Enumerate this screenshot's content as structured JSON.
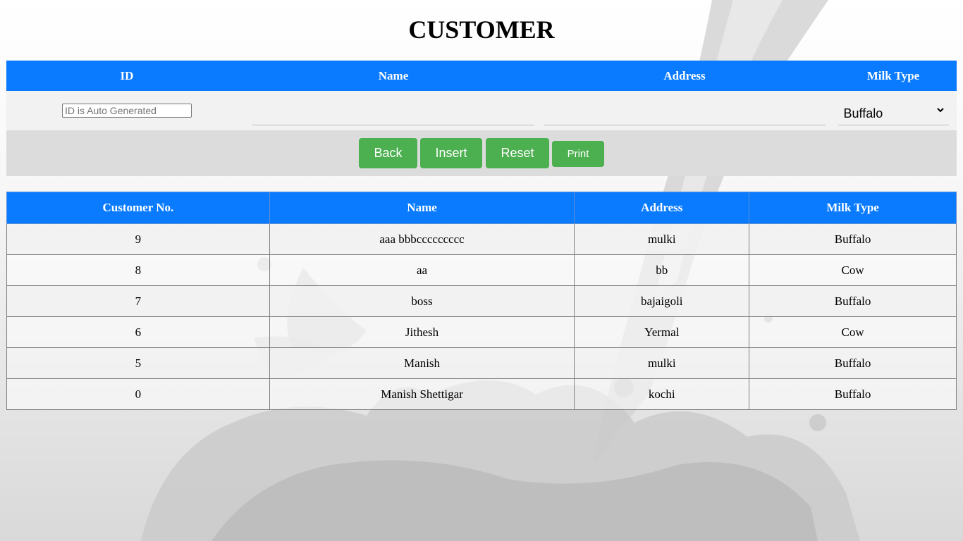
{
  "page": {
    "title": "CUSTOMER"
  },
  "form": {
    "headers": {
      "id": "ID",
      "name": "Name",
      "address": "Address",
      "milk_type": "Milk Type"
    },
    "id_placeholder": "ID is Auto Generated",
    "name_value": "",
    "address_value": "",
    "milk_type_selected": "Buffalo"
  },
  "buttons": {
    "back": "Back",
    "insert": "Insert",
    "reset": "Reset",
    "print": "Print"
  },
  "table": {
    "headers": {
      "customer_no": "Customer No.",
      "name": "Name",
      "address": "Address",
      "milk_type": "Milk Type"
    },
    "rows": [
      {
        "customer_no": "9",
        "name": "aaa bbbccccccccc",
        "address": "mulki",
        "milk_type": "Buffalo"
      },
      {
        "customer_no": "8",
        "name": "aa",
        "address": "bb",
        "milk_type": "Cow"
      },
      {
        "customer_no": "7",
        "name": "boss",
        "address": "bajaigoli",
        "milk_type": "Buffalo"
      },
      {
        "customer_no": "6",
        "name": "Jithesh",
        "address": "Yermal",
        "milk_type": "Cow"
      },
      {
        "customer_no": "5",
        "name": "Manish",
        "address": "mulki",
        "milk_type": "Buffalo"
      },
      {
        "customer_no": "0",
        "name": "Manish Shettigar",
        "address": "kochi",
        "milk_type": "Buffalo"
      }
    ]
  },
  "colors": {
    "header_blue": "#0a7bff",
    "button_green": "#4caf50"
  }
}
